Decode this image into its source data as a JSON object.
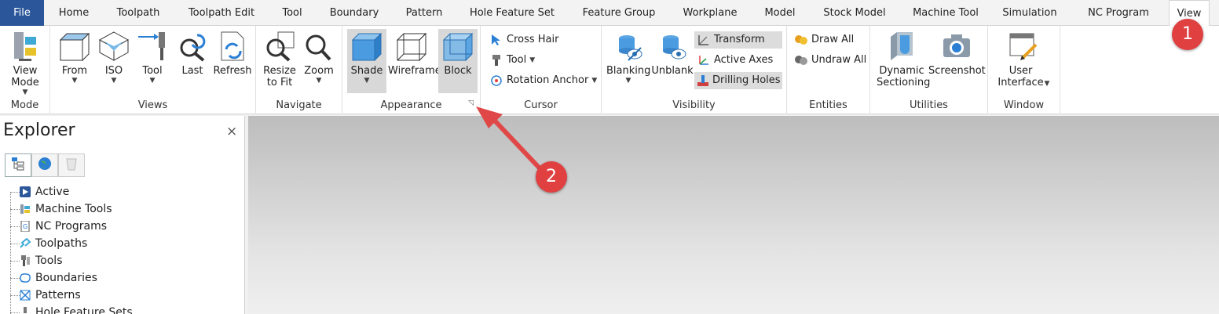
{
  "tabs": [
    {
      "label": "File",
      "left": 0
    },
    {
      "label": "Home"
    },
    {
      "label": "Toolpath"
    },
    {
      "label": "Toolpath Edit"
    },
    {
      "label": "Tool"
    },
    {
      "label": "Boundary"
    },
    {
      "label": "Pattern"
    },
    {
      "label": "Hole Feature Set"
    },
    {
      "label": "Feature Group"
    },
    {
      "label": "Workplane"
    },
    {
      "label": "Model"
    },
    {
      "label": "Stock Model"
    },
    {
      "label": "Machine Tool"
    },
    {
      "label": "Simulation"
    },
    {
      "label": "NC Program"
    },
    {
      "label": "View"
    }
  ],
  "ribbon": {
    "mode": {
      "label": "Mode",
      "view_mode": "View Mode"
    },
    "views": {
      "label": "Views",
      "from": "From",
      "iso": "ISO",
      "tool": "Tool",
      "last": "Last",
      "refresh": "Refresh"
    },
    "navigate": {
      "label": "Navigate",
      "resize": "Resize to Fit",
      "zoom": "Zoom"
    },
    "appearance": {
      "label": "Appearance",
      "shade": "Shade",
      "wireframe": "Wireframe",
      "block": "Block"
    },
    "cursor": {
      "label": "Cursor",
      "cross_hair": "Cross Hair",
      "tool": "Tool",
      "rotation_anchor": "Rotation Anchor"
    },
    "visibility": {
      "label": "Visibility",
      "blanking": "Blanking",
      "unblank": "Unblank",
      "transform": "Transform",
      "active_axes": "Active Axes",
      "drilling_holes": "Drilling Holes"
    },
    "entities": {
      "label": "Entities",
      "draw_all": "Draw All",
      "undraw_all": "Undraw All"
    },
    "utilities": {
      "label": "Utilities",
      "dynamic_sectioning": "Dynamic Sectioning",
      "screenshot": "Screenshot"
    },
    "window": {
      "label": "Window",
      "user_interface": "User Interface"
    }
  },
  "explorer": {
    "title": "Explorer",
    "close": "×",
    "items": [
      "Active",
      "Machine Tools",
      "NC Programs",
      "Toolpaths",
      "Tools",
      "Boundaries",
      "Patterns",
      "Hole Feature Sets"
    ]
  },
  "annotations": {
    "badge1": "1",
    "badge2": "2"
  },
  "colors": {
    "file_tab": "#2b579a",
    "badge": "#e04040",
    "icon_blue": "#3f8fd6"
  }
}
